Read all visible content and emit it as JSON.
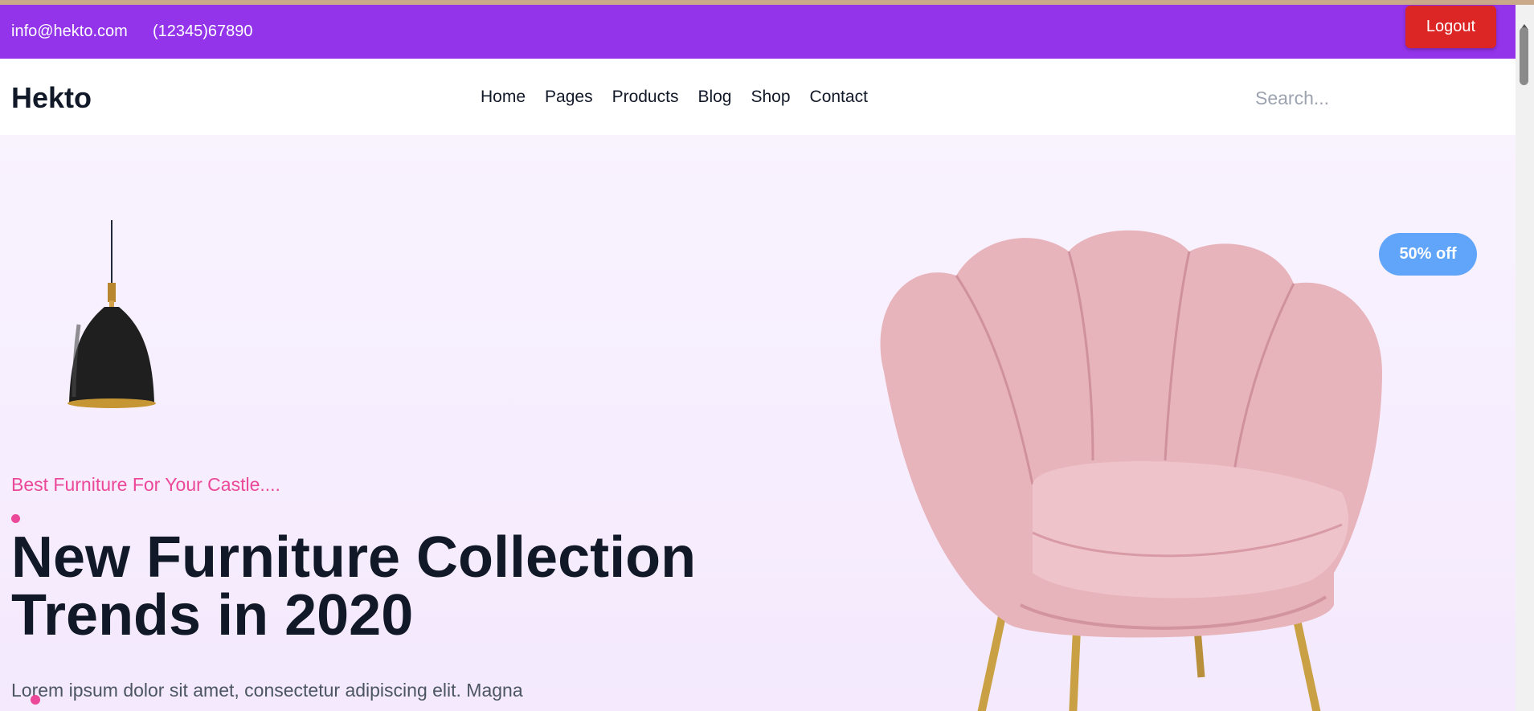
{
  "topbar": {
    "email": "info@hekto.com",
    "phone": "(12345)67890",
    "logout_label": "Logout",
    "bg_color": "#9333ea",
    "logout_color": "#dc2626"
  },
  "navbar": {
    "logo": "Hekto",
    "items": [
      "Home",
      "Pages",
      "Products",
      "Blog",
      "Shop",
      "Contact"
    ],
    "search_placeholder": "Search..."
  },
  "hero": {
    "tagline": "Best Furniture For Your Castle....",
    "headline_line1": "New Furniture Collection",
    "headline_line2": "Trends in 2020",
    "description": "Lorem ipsum dolor sit amet, consectetur adipiscing elit. Magna",
    "badge": "50% off",
    "accent_color": "#ec4899",
    "badge_color": "#60a5fa",
    "images": [
      "pendant-lamp",
      "pink-armchair"
    ]
  }
}
